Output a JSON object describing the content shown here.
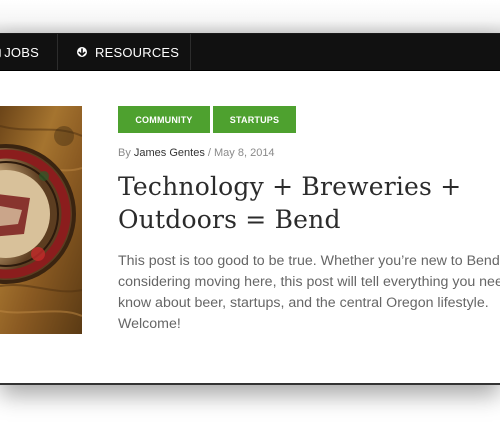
{
  "nav": {
    "items": [
      {
        "label": "JOBS",
        "icon": "briefcase-icon"
      },
      {
        "label": "RESOURCES",
        "icon": "circle-arrow-icon"
      }
    ]
  },
  "post": {
    "image_alt": "Brewery coaster on wooden table",
    "tags": [
      "COMMUNITY",
      "STARTUPS"
    ],
    "byline": {
      "prefix": "By",
      "author": "James Gentes",
      "separator": "/",
      "date": "May 8, 2014"
    },
    "title_lines": [
      "Technology + Breweries +",
      "Outdoors = Bend"
    ],
    "excerpt_lines": [
      "This post is too good to be true. Whether you’re new to Bend or",
      "considering moving here, this post will tell everything you need to",
      "know about beer, startups, and the central Oregon lifestyle.",
      "Welcome!"
    ]
  },
  "colors": {
    "nav_bg": "#111111",
    "tag_green": "#4ea12f",
    "title": "#2b2b2b",
    "body_text": "#666666"
  }
}
